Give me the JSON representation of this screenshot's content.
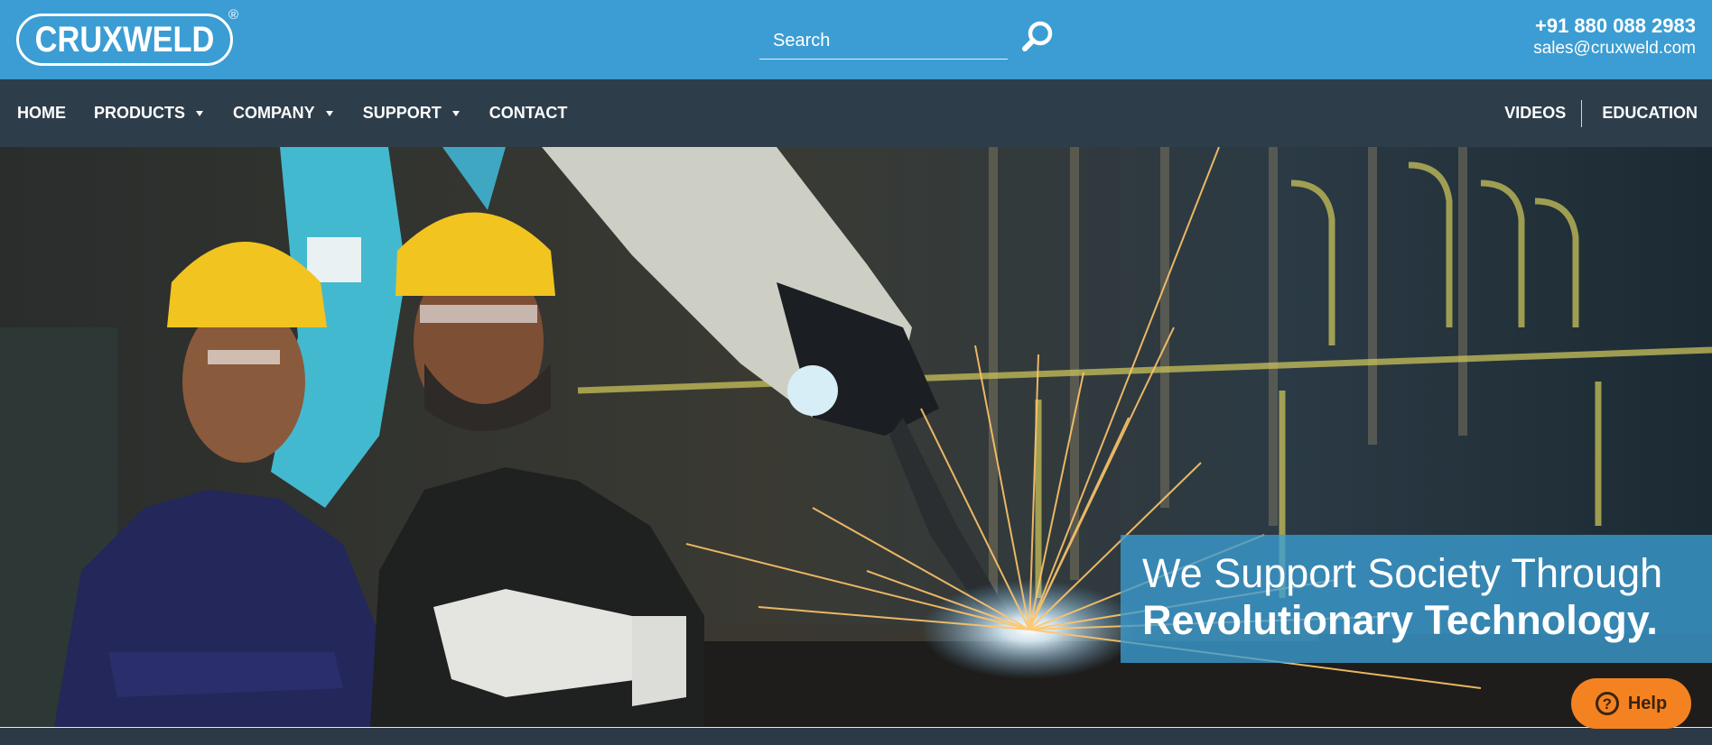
{
  "header": {
    "logo_text": "CRUXWELD",
    "logo_reg": "®",
    "search": {
      "placeholder": "Search",
      "value": ""
    },
    "phone": "+91 880 088 2983",
    "email": "sales@cruxweld.com"
  },
  "nav": {
    "left": [
      {
        "label": "HOME"
      },
      {
        "label": "PRODUCTS"
      },
      {
        "label": "COMPANY"
      },
      {
        "label": "SUPPORT"
      },
      {
        "label": "CONTACT"
      }
    ],
    "right": [
      {
        "label": "VIDEOS"
      },
      {
        "label": "EDUCATION"
      }
    ]
  },
  "hero": {
    "caption_line1": "We Support Society Through",
    "caption_line2": "Revolutionary Technology."
  },
  "help": {
    "label": "Help",
    "icon_glyph": "?"
  },
  "colors": {
    "brand_blue": "#3b9dd3",
    "nav_dark": "#2e3d4a",
    "help_orange": "#f58220"
  }
}
